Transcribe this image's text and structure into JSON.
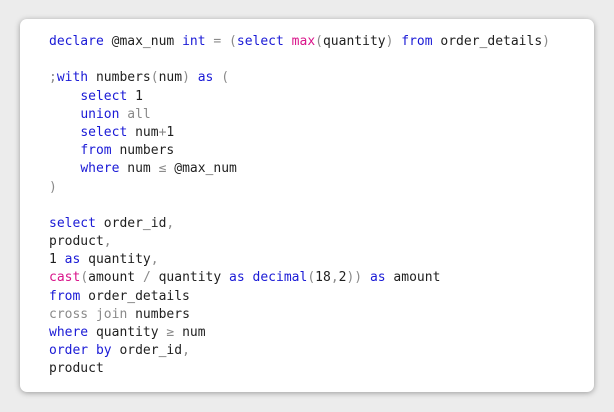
{
  "code_lines": [
    [
      {
        "t": "declare ",
        "c": "kw"
      },
      {
        "t": "@max_num ",
        "c": "pl"
      },
      {
        "t": "int",
        "c": "kw"
      },
      {
        "t": " ",
        "c": "pl"
      },
      {
        "t": "=",
        "c": "gr"
      },
      {
        "t": " ",
        "c": "pl"
      },
      {
        "t": "(",
        "c": "gr"
      },
      {
        "t": "select",
        "c": "kw"
      },
      {
        "t": " ",
        "c": "pl"
      },
      {
        "t": "max",
        "c": "fn"
      },
      {
        "t": "(",
        "c": "gr"
      },
      {
        "t": "quantity",
        "c": "pl"
      },
      {
        "t": ")",
        "c": "gr"
      },
      {
        "t": " ",
        "c": "pl"
      },
      {
        "t": "from",
        "c": "kw"
      },
      {
        "t": " order_details",
        "c": "pl"
      },
      {
        "t": ")",
        "c": "gr"
      }
    ],
    [],
    [
      {
        "t": ";",
        "c": "gr"
      },
      {
        "t": "with",
        "c": "kw"
      },
      {
        "t": " numbers",
        "c": "pl"
      },
      {
        "t": "(",
        "c": "gr"
      },
      {
        "t": "num",
        "c": "pl"
      },
      {
        "t": ")",
        "c": "gr"
      },
      {
        "t": " ",
        "c": "pl"
      },
      {
        "t": "as",
        "c": "kw"
      },
      {
        "t": " ",
        "c": "pl"
      },
      {
        "t": "(",
        "c": "gr"
      }
    ],
    [
      {
        "t": "    ",
        "c": "pl"
      },
      {
        "t": "select",
        "c": "kw"
      },
      {
        "t": " 1",
        "c": "pl"
      }
    ],
    [
      {
        "t": "    ",
        "c": "pl"
      },
      {
        "t": "union",
        "c": "kw"
      },
      {
        "t": " ",
        "c": "pl"
      },
      {
        "t": "all",
        "c": "gr"
      }
    ],
    [
      {
        "t": "    ",
        "c": "pl"
      },
      {
        "t": "select",
        "c": "kw"
      },
      {
        "t": " num",
        "c": "pl"
      },
      {
        "t": "+",
        "c": "gr"
      },
      {
        "t": "1",
        "c": "pl"
      }
    ],
    [
      {
        "t": "    ",
        "c": "pl"
      },
      {
        "t": "from",
        "c": "kw"
      },
      {
        "t": " numbers",
        "c": "pl"
      }
    ],
    [
      {
        "t": "    ",
        "c": "pl"
      },
      {
        "t": "where",
        "c": "kw"
      },
      {
        "t": " num ",
        "c": "pl"
      },
      {
        "t": "≤",
        "c": "gr"
      },
      {
        "t": " @max_num",
        "c": "pl"
      }
    ],
    [
      {
        "t": ")",
        "c": "gr"
      }
    ],
    [],
    [
      {
        "t": "select",
        "c": "kw"
      },
      {
        "t": " order_id",
        "c": "pl"
      },
      {
        "t": ",",
        "c": "gr"
      }
    ],
    [
      {
        "t": "product",
        "c": "pl"
      },
      {
        "t": ",",
        "c": "gr"
      }
    ],
    [
      {
        "t": "1 ",
        "c": "pl"
      },
      {
        "t": "as",
        "c": "kw"
      },
      {
        "t": " quantity",
        "c": "pl"
      },
      {
        "t": ",",
        "c": "gr"
      }
    ],
    [
      {
        "t": "cast",
        "c": "fn"
      },
      {
        "t": "(",
        "c": "gr"
      },
      {
        "t": "amount ",
        "c": "pl"
      },
      {
        "t": "/",
        "c": "gr"
      },
      {
        "t": " quantity ",
        "c": "pl"
      },
      {
        "t": "as",
        "c": "kw"
      },
      {
        "t": " ",
        "c": "pl"
      },
      {
        "t": "decimal",
        "c": "kw"
      },
      {
        "t": "(",
        "c": "gr"
      },
      {
        "t": "18",
        "c": "pl"
      },
      {
        "t": ",",
        "c": "gr"
      },
      {
        "t": "2",
        "c": "pl"
      },
      {
        "t": "))",
        "c": "gr"
      },
      {
        "t": " ",
        "c": "pl"
      },
      {
        "t": "as",
        "c": "kw"
      },
      {
        "t": " amount",
        "c": "pl"
      }
    ],
    [
      {
        "t": "from",
        "c": "kw"
      },
      {
        "t": " order_details",
        "c": "pl"
      }
    ],
    [
      {
        "t": "cross join",
        "c": "gr"
      },
      {
        "t": " numbers",
        "c": "pl"
      }
    ],
    [
      {
        "t": "where",
        "c": "kw"
      },
      {
        "t": " quantity ",
        "c": "pl"
      },
      {
        "t": "≥",
        "c": "gr"
      },
      {
        "t": " num",
        "c": "pl"
      }
    ],
    [
      {
        "t": "order",
        "c": "kw"
      },
      {
        "t": " ",
        "c": "pl"
      },
      {
        "t": "by",
        "c": "kw"
      },
      {
        "t": " order_id",
        "c": "pl"
      },
      {
        "t": ",",
        "c": "gr"
      }
    ],
    [
      {
        "t": "product",
        "c": "pl"
      }
    ]
  ],
  "colors": {
    "keyword": "#1a1ad6",
    "function": "#d9148a",
    "operator": "#8a8a8a",
    "text": "#1f1f1f",
    "background": "#ffffff"
  }
}
